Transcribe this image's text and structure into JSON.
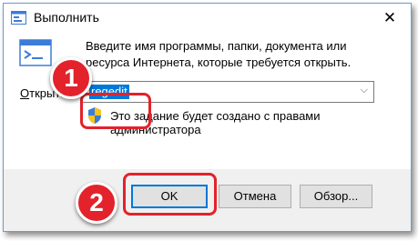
{
  "window": {
    "title": "Выполнить",
    "close_glyph": "✕",
    "icon": "run-icon"
  },
  "dialog": {
    "description": "Введите имя программы, папки, документа или ресурса Интернета, которые требуется открыть.",
    "open_label_accel": "О",
    "open_label_rest": "ткрыть:",
    "input_value": "regedit",
    "dropdown_glyph": "⌵",
    "admin_note": "Это задание будет создано с правами администратора"
  },
  "buttons": {
    "ok": "OK",
    "cancel": "Отмена",
    "browse": "Обзор..."
  },
  "annotations": {
    "step1": "1",
    "step2": "2",
    "highlight_color": "#e3222b",
    "accent_color": "#0078d7"
  }
}
